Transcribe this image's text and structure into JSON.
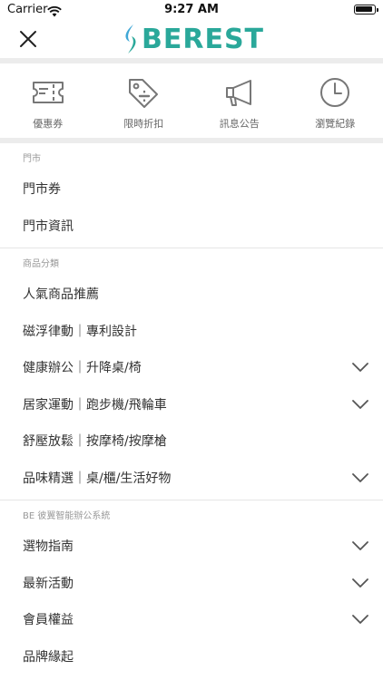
{
  "status_bar": {
    "carrier": "Carrier",
    "time": "9:27 AM"
  },
  "header": {
    "logo_text": "BEREST",
    "brand_color": "#2aa89a"
  },
  "quick_links": [
    {
      "label": "優惠券",
      "icon": "ticket-icon"
    },
    {
      "label": "限時折扣",
      "icon": "tag-icon"
    },
    {
      "label": "訊息公告",
      "icon": "megaphone-icon"
    },
    {
      "label": "瀏覽紀錄",
      "icon": "clock-icon"
    }
  ],
  "sections": [
    {
      "title": "門市",
      "items": [
        {
          "label": "門市券",
          "expandable": false
        },
        {
          "label": "門市資訊",
          "expandable": false
        }
      ]
    },
    {
      "title": "商品分類",
      "items": [
        {
          "label": "人氣商品推薦",
          "expandable": false
        },
        {
          "label": "磁浮律動｜專利設計",
          "expandable": false
        },
        {
          "label": "健康辦公｜升降桌/椅",
          "expandable": true
        },
        {
          "label": "居家運動｜跑步機/飛輪車",
          "expandable": true
        },
        {
          "label": "舒壓放鬆｜按摩椅/按摩槍",
          "expandable": false
        },
        {
          "label": "品味精選｜桌/櫃/生活好物",
          "expandable": true
        }
      ]
    },
    {
      "title": "BE 彼翼智能辦公系統",
      "items": [
        {
          "label": "選物指南",
          "expandable": true
        },
        {
          "label": "最新活動",
          "expandable": true
        },
        {
          "label": "會員權益",
          "expandable": true
        },
        {
          "label": "品牌緣起",
          "expandable": false
        }
      ]
    }
  ]
}
